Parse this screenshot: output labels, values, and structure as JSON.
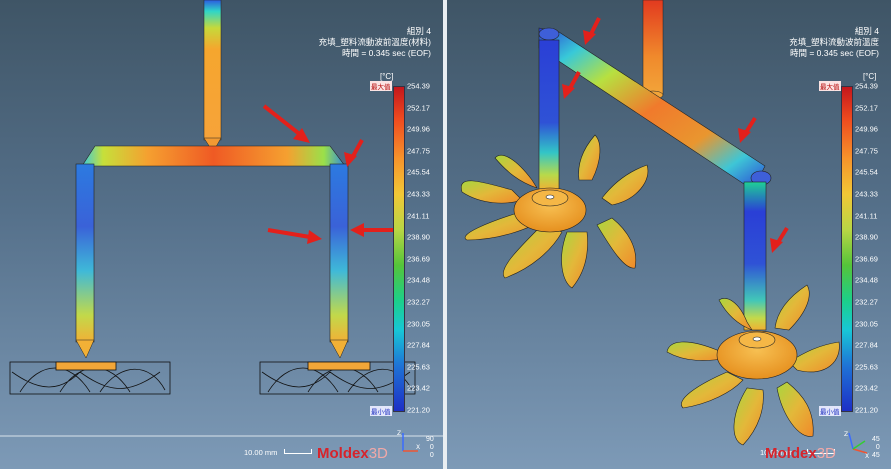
{
  "left_panel": {
    "header": {
      "line1": "組別 4",
      "line2": "充填_塑料流動波前溫度(材料)",
      "line3": "時間 = 0.345 sec  (EOF)"
    },
    "unit": "[°C]",
    "max_label": "最大值",
    "min_label": "最小值",
    "ticks": [
      "254.39",
      "252.17",
      "249.96",
      "247.75",
      "245.54",
      "243.33",
      "241.11",
      "238.90",
      "236.69",
      "234.48",
      "232.27",
      "230.05",
      "227.84",
      "225.63",
      "223.42",
      "221.20"
    ],
    "scale_text": "10.00 mm",
    "logo_main": "Moldex",
    "logo_suffix": "3D",
    "axis_values": [
      "90",
      "0",
      "0"
    ]
  },
  "right_panel": {
    "header": {
      "line1": "組別 4",
      "line2": "充填_塑料流動波前溫度",
      "line3": "時間 = 0.345 sec  (EOF)"
    },
    "unit": "[°C]",
    "max_label": "最大值",
    "min_label": "最小值",
    "ticks": [
      "254.39",
      "252.17",
      "249.96",
      "247.75",
      "245.54",
      "243.33",
      "241.11",
      "238.90",
      "236.69",
      "234.48",
      "232.27",
      "230.05",
      "227.84",
      "225.63",
      "223.42",
      "221.20"
    ],
    "scale_text": "10.00 mm",
    "logo_main": "Moldex",
    "logo_suffix": "3D",
    "axis_values": [
      "45",
      "0",
      "45"
    ]
  },
  "colors": {
    "max": "#c4161c",
    "min": "#1d2fc6",
    "arrow": "#e3201b"
  }
}
